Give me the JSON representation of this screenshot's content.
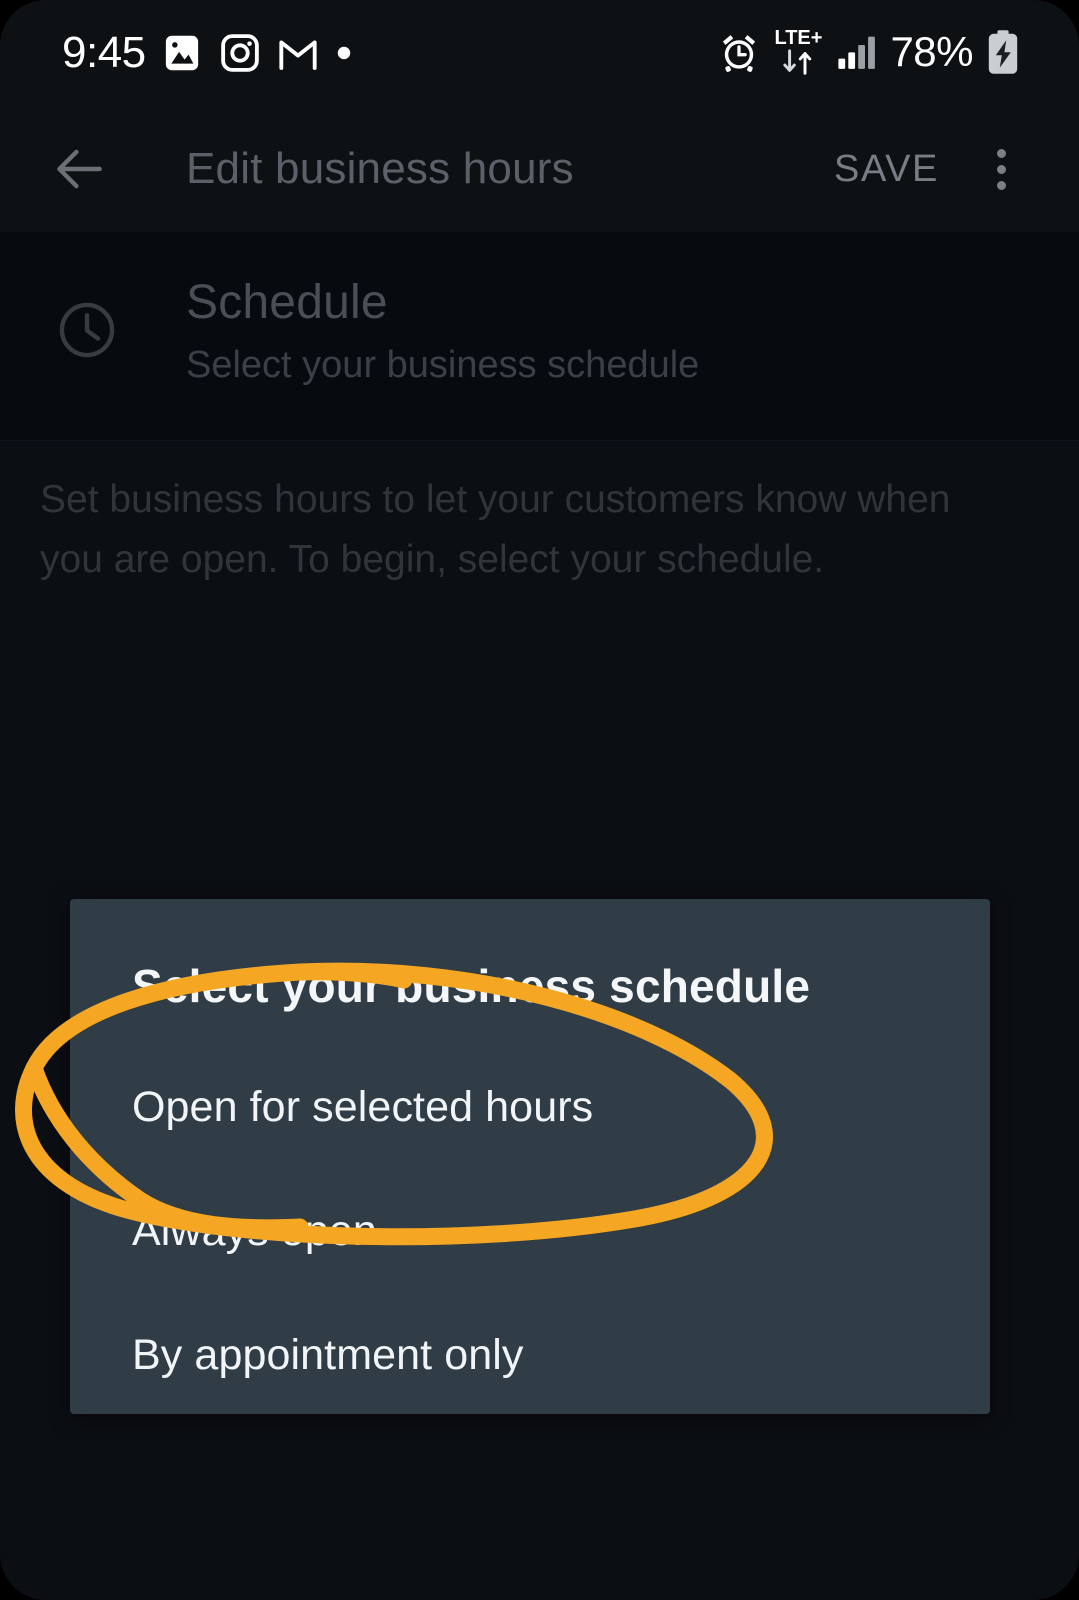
{
  "status_bar": {
    "clock": "9:45",
    "icons": [
      "photos-icon",
      "instagram-icon",
      "gmail-icon",
      "dot-indicator-icon"
    ],
    "alarm_icon": "alarm-icon",
    "network_label": "LTE+",
    "data_arrows_icon": "data-transfer-arrows-icon",
    "signal_icon": "signal-bars-icon",
    "battery_percent": "78%",
    "battery_icon": "battery-charging-icon"
  },
  "app_bar": {
    "back_icon": "back-arrow-icon",
    "title": "Edit business hours",
    "save_label": "SAVE",
    "overflow_icon": "overflow-menu-icon"
  },
  "schedule_header": {
    "icon": "clock-icon",
    "title": "Schedule",
    "subtitle": "Select your business schedule"
  },
  "body": {
    "description": "Set business hours to let your customers know when you are open. To begin, select your schedule."
  },
  "dialog": {
    "title": "Select your business schedule",
    "options": [
      {
        "label": "Open for selected hours"
      },
      {
        "label": "Always open"
      },
      {
        "label": "By appointment only"
      }
    ]
  },
  "annotation": {
    "shape": "hand-drawn-ellipse",
    "color": "#f5a623",
    "target": "Open for selected hours"
  },
  "colors": {
    "page_background": "#0b0e13",
    "app_bar_background": "#0d1114",
    "content_background": "#070a0f",
    "dialog_background": "#303d47",
    "annotation_orange": "#f5a623",
    "dialog_text": "#f2f5f7",
    "dimmed_text": "#4a4f55"
  }
}
